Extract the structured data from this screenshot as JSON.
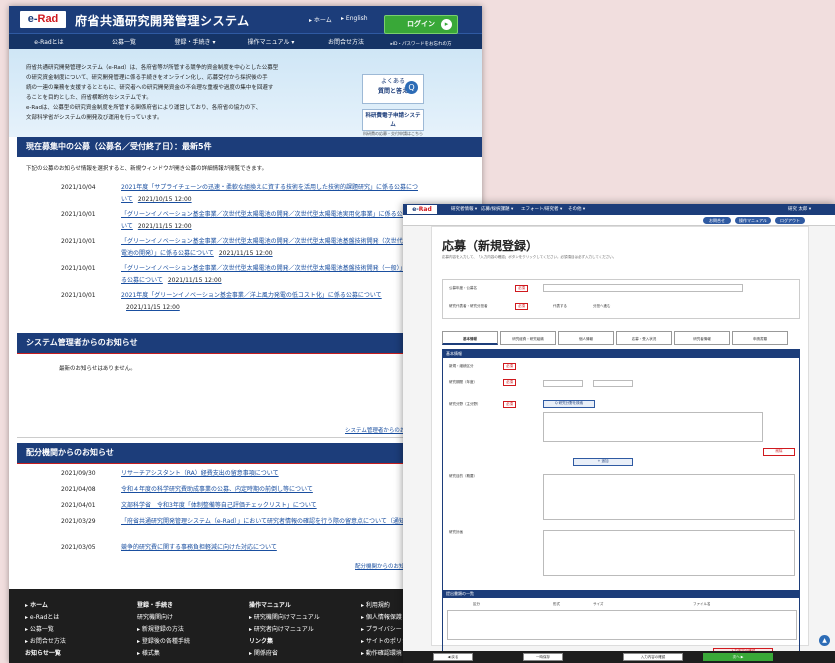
{
  "left": {
    "logo": {
      "e": "e-",
      "rad": "Rad"
    },
    "site_title": "府省共通研究開発管理システム",
    "toplinks": [
      "▸ ホーム",
      "▸ English"
    ],
    "login": {
      "label": "ログイン",
      "arrow": "▸"
    },
    "pw_link": "▸ID・パスワードをお忘れの方",
    "nav": [
      "e-Radとは",
      "公募一覧",
      "登録・手続き ▾",
      "操作マニュアル ▾",
      "お問合せ方法"
    ],
    "intro": [
      "府省共通研究開発管理システム（e-Rad）は、各府省等が所管する競争的資金制度を中心とした公募型",
      "の研究資金制度について、研究開発管理に係る手続きをオンライン化し、応募受付から採択後の手",
      "続の一連の業務を支援するとともに、研究者への研究開発資金の不合理な重複や過度の集中を回避す",
      "ることを目的とした、府省横断的なシステムです。",
      "e-Radは、公募型の研究資金制度を所管する関係府省により運営しており、各府省の協力の下、",
      "文部科学省がシステムの開発及び運用を行っています。"
    ],
    "faq_banner": {
      "line1": "よくある",
      "line2": "質問と答え",
      "icon": "Q"
    },
    "kaken_banner": {
      "line1": "科研費電子申請システム",
      "line2": "科研費の応募・交付申請はこちら"
    },
    "recruit": {
      "heading": "現在募集中の公募（公募名／受付終了日）：最新5件",
      "desc": "下記の公募のお知らせ情報を選択すると、新規ウィンドウが開き公募の詳細情報が閲覧できます。",
      "rows": [
        {
          "date": "2021/10/04",
          "text": "2021年度「サプライチェーンの迅速・柔軟な組換えに資する技術を活用した技術的課題研究」に係る公募について",
          "deadline": "2021/10/15 12:00"
        },
        {
          "date": "2021/10/01",
          "text": "「グリーンイノベーション基金事業／次世代型太陽電池の開発／次世代型太陽電池実用化事業」に係る公募について",
          "deadline": "2021/11/15 12:00"
        },
        {
          "date": "2021/10/01",
          "text": "「グリーンイノベーション基金事業／次世代型太陽電池の開発／次世代型太陽電池基盤技術開発（次世代型太陽電池の開発）」に係る公募について",
          "deadline": "2021/11/15 12:00"
        },
        {
          "date": "2021/10/01",
          "text": "「グリーンイノベーション基金事業／次世代型太陽電池の開発／次世代型太陽電池基盤技術開発（一般）」に係る公募について",
          "deadline": "2021/11/15 12:00"
        },
        {
          "date": "2021/10/01",
          "text": "2021年度「グリーンイノベーション基金事業／洋上風力発電の低コスト化」に係る公募について",
          "deadline": "2021/11/15 12:00"
        }
      ]
    },
    "admin": {
      "heading": "システム管理者からのお知らせ",
      "empty": "最新のお知らせはありません。",
      "more": "システム管理者からのお知らせ"
    },
    "agency": {
      "heading": "配分機関からのお知らせ",
      "rows": [
        {
          "date": "2021/09/30",
          "text": "リサーチアシスタント（RA）経費支出の留意事項について"
        },
        {
          "date": "2021/04/08",
          "text": "令和４年度の科学研究費助成事業の公募、内定時期の前倒し等について"
        },
        {
          "date": "2021/04/01",
          "text": "文部科学省　令和3年度「体制整備等自己評価チェックリスト」について"
        },
        {
          "date": "2021/03/29",
          "text": "「府省共通研究開発管理システム（e-Rad）」において研究者情報の確認を行う際の留意点について（通知）"
        },
        {
          "date": "2021/03/05",
          "text": "競争的研究費に関する事務負担軽減に向けた対応について"
        }
      ],
      "more": "配分機関からのお知らせ"
    },
    "footer": [
      {
        "head": "▸ ホーム",
        "items": [
          "▸ e-Radとは",
          "▸ 公募一覧",
          "▸ お問合せ方法",
          "お知らせ一覧"
        ]
      },
      {
        "head": "登録・手続き",
        "items": [
          "研究機関向け",
          "▸ 新規登録の方法",
          "▸ 登録後の各種手続",
          "▸ 様式集"
        ]
      },
      {
        "head": "操作マニュアル",
        "items": [
          "▸ 研究機関向けマニュアル",
          "▸ 研究者向けマニュアル",
          "リンク集",
          "▸ 関係府省"
        ]
      },
      {
        "head": "▸ 利用規約",
        "items": [
          "▸ 個人情報保護",
          "▸ プライバシー",
          "▸ サイトのポリシー",
          "▸ 動作確認環境"
        ]
      }
    ]
  },
  "right": {
    "logo": {
      "e": "e-",
      "rad": "Rad"
    },
    "nav": [
      "研究者情報 ▾",
      "応募/採択課題 ▾",
      "エフォート/研究者 ▾",
      "その他 ▾"
    ],
    "user": "研究 太郎 ▾",
    "subpills": [
      "お問合せ",
      "操作マニュアル",
      "ログアウト"
    ],
    "title": "応募（新規登録）",
    "note": "応募内容を入力して、「入力内容の確認」ボタンをクリックしてください。必須項目は必ず入力してください。",
    "form1": {
      "label1": "公募年度・公募名",
      "label2": "研究代表者・研究分担者",
      "req": "必須",
      "radio": [
        "代表する",
        "分担へ進む"
      ]
    },
    "tabs": [
      "基本情報",
      "研究経費・研究組織",
      "個人情報",
      "応募・受入状況",
      "研究者情報",
      "申請書類"
    ],
    "section1": "基本情報",
    "labels": [
      "新規・継続区分",
      "研究期間（年度）",
      "研究分野（主分野）",
      "研究目的（概要）",
      "研究計画"
    ],
    "req": "必須",
    "search_btn": "Q 研究分野を検索",
    "add_btn": "+ 追加",
    "delete_btn": "削除",
    "section2": "提出書類の一覧",
    "table_heads": [
      "区分",
      "形式",
      "サイズ",
      "ファイル名"
    ],
    "confirm_btn": "入力内容の確認",
    "bottom": [
      "◀ 戻る",
      "一時保存",
      "入力内容の確認",
      "次へ ▶"
    ],
    "up": "▲"
  }
}
